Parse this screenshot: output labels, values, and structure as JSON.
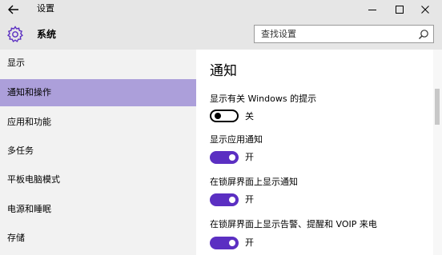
{
  "window": {
    "title": "设置",
    "icons": {
      "back": "back-arrow-icon",
      "minimize": "minimize-icon",
      "maximize": "maximize-icon",
      "close": "close-icon"
    }
  },
  "header": {
    "section_title": "系统",
    "section_icon": "gear-icon",
    "search": {
      "placeholder": "查找设置",
      "icon": "search-icon"
    }
  },
  "sidebar": {
    "items": [
      {
        "label": "显示",
        "selected": false
      },
      {
        "label": "通知和操作",
        "selected": true
      },
      {
        "label": "应用和功能",
        "selected": false
      },
      {
        "label": "多任务",
        "selected": false
      },
      {
        "label": "平板电脑模式",
        "selected": false
      },
      {
        "label": "电源和睡眠",
        "selected": false
      },
      {
        "label": "存储",
        "selected": false
      }
    ]
  },
  "main": {
    "title": "通知",
    "settings": [
      {
        "label": "显示有关 Windows 的提示",
        "state": "关",
        "on": false
      },
      {
        "label": "显示应用通知",
        "state": "开",
        "on": true
      },
      {
        "label": "在锁屏界面上显示通知",
        "state": "开",
        "on": true
      },
      {
        "label": "在锁屏界面上显示告警、提醒和 VOIP 来电",
        "state": "开",
        "on": true
      }
    ]
  },
  "colors": {
    "accent": "#5b2fc2",
    "selected_nav": "#ac9fda",
    "header_bg": "#e6e6e6",
    "sidebar_bg": "#f2f2f2"
  }
}
